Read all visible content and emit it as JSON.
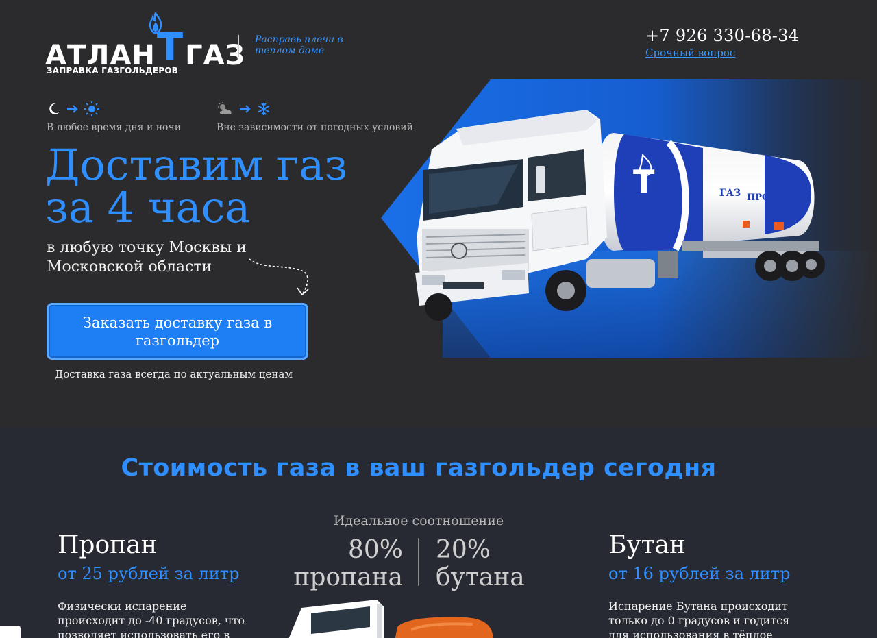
{
  "header": {
    "logo_word_left": "АТЛАН",
    "logo_word_t": "Т",
    "logo_word_right": "ГАЗ",
    "logo_subtitle": "ЗАПРАВКА ГАЗГОЛЬДЕРОВ",
    "tagline": "Расправь плечи в теплом доме",
    "phone": "+7 926 330-68-34",
    "urgent_link": "Срочный вопрос"
  },
  "features": [
    {
      "icons": [
        "moon-icon",
        "arrow-right-icon",
        "sun-icon"
      ],
      "text": "В любое время дня и ночи"
    },
    {
      "icons": [
        "cloud-sun-icon",
        "arrow-right-icon",
        "snowflake-icon"
      ],
      "text": "Вне зависимости от погодных условий"
    }
  ],
  "hero": {
    "headline": "Доставим газ за 4 часа",
    "subheadline": "в любую точку Москвы и Московской области",
    "cta_label": "Заказать доставку газа в газгольдер",
    "price_note": "Доставка газа всегда по актуальным ценам",
    "truck_tank_text_1": "ГАЗ",
    "truck_tank_text_2": "ПРОПАН"
  },
  "price_section": {
    "title": "Стоимость газа в ваш газгольдер сегодня",
    "ratio_label": "Идеальное соотношение",
    "ratio_left": "80% пропана",
    "ratio_right": "20% бутана",
    "propane": {
      "title": "Пропан",
      "price": "от 25 рублей за литр",
      "desc": "Физически испарение происходит до -40 градусов, что позволяет использовать его в"
    },
    "butane": {
      "title": "Бутан",
      "price": "от 16 рублей за литр",
      "desc": "Испарение Бутана происходит только до 0 градусов и годится для использования в тёплое"
    }
  },
  "colors": {
    "background": "#2b2b2d",
    "section_background": "#272a33",
    "accent": "#2f8fff",
    "button": "#1e7ff5",
    "text": "#ffffff"
  }
}
